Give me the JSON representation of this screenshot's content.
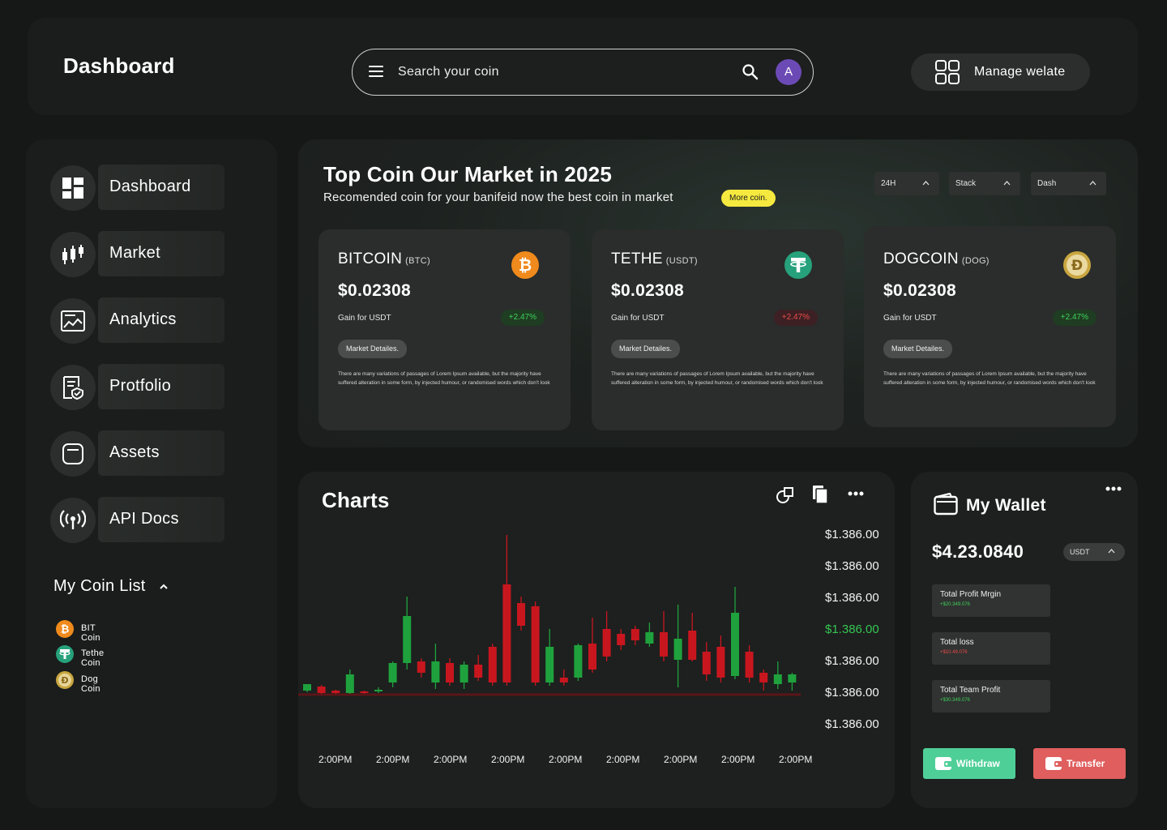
{
  "header": {
    "title": "Dashboard",
    "search_placeholder": "Search your coin",
    "avatar_initial": "A",
    "manage_label": "Manage welate"
  },
  "sidebar": {
    "items": [
      {
        "label": "Dashboard",
        "icon": "dashboard-icon"
      },
      {
        "label": "Market",
        "icon": "candlestick-icon"
      },
      {
        "label": "Analytics",
        "icon": "analytics-icon"
      },
      {
        "label": "Protfolio",
        "icon": "portfolio-icon"
      },
      {
        "label": "Assets",
        "icon": "assets-icon"
      },
      {
        "label": "API Docs",
        "icon": "broadcast-icon"
      }
    ],
    "coin_list_title": "My Coin List",
    "coins": [
      {
        "name": "BIT Coin",
        "icon": "bitcoin-icon"
      },
      {
        "name": "Tethe Coin",
        "icon": "tether-icon"
      },
      {
        "name": "Dog Coin",
        "icon": "doge-icon"
      }
    ]
  },
  "top": {
    "title": "Top Coin Our Market in 2025",
    "subtitle": "Recomended coin for your banifeid now the best coin in market",
    "more_label": "More coin.",
    "filters": [
      "24H",
      "Stack",
      "Dash"
    ],
    "cards": [
      {
        "name": "BITCOIN",
        "symbol": "(BTC)",
        "price": "$0.02308",
        "gain_label": "Gain for USDT",
        "change": "+2.47%",
        "trend": "up",
        "details_label": "Market Detailes.",
        "description": "There are many variations of passages of Lorem Ipsum available, but the majority have suffered alteration in some form, by injected humour, or randomised words which don't look",
        "icon": "bitcoin-icon"
      },
      {
        "name": "TETHE",
        "symbol": "(USDT)",
        "price": "$0.02308",
        "gain_label": "Gain for USDT",
        "change": "+2.47%",
        "trend": "down",
        "details_label": "Market Detailes.",
        "description": "There are many variations of passages of Lorem Ipsum available, but the majority have suffered alteration in some form, by injected humour, or randomised words which don't look",
        "icon": "tether-icon"
      },
      {
        "name": "DOGCOIN",
        "symbol": "(DOG)",
        "price": "$0.02308",
        "gain_label": "Gain for USDT",
        "change": "+2.47%",
        "trend": "up",
        "details_label": "Market Detailes.",
        "description": "There are many variations of passages of Lorem Ipsum available, but the majority have suffered alteration in some form, by injected humour, or randomised words which don't look",
        "icon": "doge-icon"
      }
    ]
  },
  "charts": {
    "title": "Charts",
    "price_labels": [
      "$1.386.00",
      "$1.386.00",
      "$1.386.00",
      "$1.386.00",
      "$1.386.00",
      "$1.386.00",
      "$1.386.00"
    ],
    "highlight_index": 3,
    "time_labels": [
      "2:00PM",
      "2:00PM",
      "2:00PM",
      "2:00PM",
      "2:00PM",
      "2:00PM",
      "2:00PM",
      "2:00PM",
      "2:00PM"
    ],
    "colors": {
      "up": "#1fa23d",
      "down": "#c8161f",
      "highlight": "#36c553"
    },
    "candles": [
      {
        "o": 4,
        "c": 12,
        "h": 12,
        "l": 2
      },
      {
        "o": 9,
        "c": 1,
        "h": 11,
        "l": 0
      },
      {
        "o": 4,
        "c": 1,
        "h": 5,
        "l": 0
      },
      {
        "o": 1,
        "c": 24,
        "h": 30,
        "l": 0
      },
      {
        "o": 3,
        "c": 1,
        "h": 4,
        "l": 0
      },
      {
        "o": 3,
        "c": 5,
        "h": 8,
        "l": 1
      },
      {
        "o": 14,
        "c": 38,
        "h": 40,
        "l": 8
      },
      {
        "o": 38,
        "c": 96,
        "h": 120,
        "l": 30
      },
      {
        "o": 40,
        "c": 26,
        "h": 44,
        "l": 20
      },
      {
        "o": 14,
        "c": 40,
        "h": 62,
        "l": 6
      },
      {
        "o": 38,
        "c": 14,
        "h": 44,
        "l": 10
      },
      {
        "o": 14,
        "c": 36,
        "h": 40,
        "l": 6
      },
      {
        "o": 36,
        "c": 20,
        "h": 48,
        "l": 16
      },
      {
        "o": 58,
        "c": 14,
        "h": 62,
        "l": 10
      },
      {
        "o": 135,
        "c": 14,
        "h": 196,
        "l": 10
      },
      {
        "o": 112,
        "c": 84,
        "h": 120,
        "l": 78
      },
      {
        "o": 108,
        "c": 14,
        "h": 114,
        "l": 10
      },
      {
        "o": 14,
        "c": 58,
        "h": 80,
        "l": 10
      },
      {
        "o": 20,
        "c": 14,
        "h": 30,
        "l": 10
      },
      {
        "o": 20,
        "c": 60,
        "h": 62,
        "l": 16
      },
      {
        "o": 62,
        "c": 30,
        "h": 94,
        "l": 26
      },
      {
        "o": 80,
        "c": 46,
        "h": 102,
        "l": 40
      },
      {
        "o": 74,
        "c": 60,
        "h": 80,
        "l": 54
      },
      {
        "o": 80,
        "c": 66,
        "h": 84,
        "l": 60
      },
      {
        "o": 62,
        "c": 76,
        "h": 88,
        "l": 58
      },
      {
        "o": 76,
        "c": 46,
        "h": 102,
        "l": 40
      },
      {
        "o": 42,
        "c": 68,
        "h": 110,
        "l": 8
      },
      {
        "o": 78,
        "c": 42,
        "h": 100,
        "l": 40
      },
      {
        "o": 52,
        "c": 24,
        "h": 64,
        "l": 16
      },
      {
        "o": 58,
        "c": 20,
        "h": 72,
        "l": 14
      },
      {
        "o": 22,
        "c": 100,
        "h": 132,
        "l": 18
      },
      {
        "o": 52,
        "c": 20,
        "h": 60,
        "l": 14
      },
      {
        "o": 26,
        "c": 14,
        "h": 30,
        "l": 4
      },
      {
        "o": 12,
        "c": 24,
        "h": 40,
        "l": 6
      },
      {
        "o": 14,
        "c": 24,
        "h": 26,
        "l": 4
      }
    ]
  },
  "wallet": {
    "title": "My Wallet",
    "balance": "$4.23.0840",
    "currency": "USDT",
    "stats": [
      {
        "label": "Total Profit Mrgin",
        "value": "+$20.349.076",
        "color": "#3fd05a"
      },
      {
        "label": "Total loss",
        "value": "+$10.49.076",
        "color": "#ec4a4a"
      },
      {
        "label": "Total Team Profit",
        "value": "+$30.349.076",
        "color": "#3fd05a"
      }
    ],
    "withdraw_label": "Withdraw",
    "transfer_label": "Transfer",
    "withdraw_color": "#4fcf98",
    "transfer_color": "#e05e5e"
  }
}
